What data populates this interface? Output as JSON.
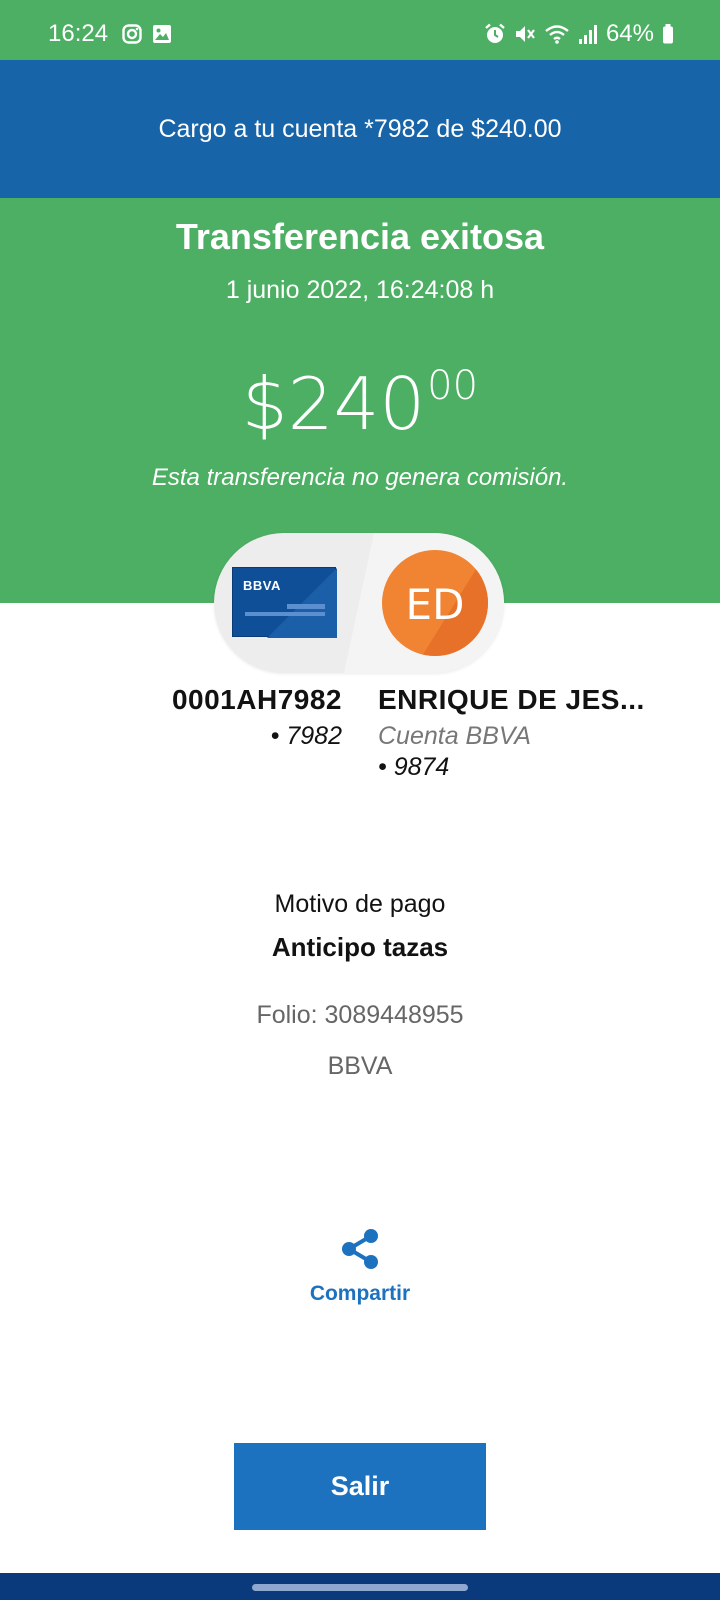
{
  "status_bar": {
    "time": "16:24",
    "battery": "64%",
    "left_icons": [
      "instagram-icon",
      "gallery-icon"
    ],
    "right_icons": [
      "alarm-icon",
      "mute-icon",
      "wifi-icon",
      "signal-icon",
      "battery-icon"
    ]
  },
  "banner": {
    "text": "Cargo a tu cuenta *7982 de $240.00"
  },
  "hero": {
    "title": "Transferencia exitosa",
    "date": "1 junio 2022, 16:24:08 h",
    "amount_main": "$240",
    "amount_cents": "00",
    "note": "Esta transferencia no genera comisión."
  },
  "origin": {
    "card_brand": "BBVA",
    "name": "0001AH7982",
    "number": "• 7982"
  },
  "destination": {
    "initials": "ED",
    "name": "ENRIQUE DE JES...",
    "bank": "Cuenta BBVA",
    "number": "• 9874"
  },
  "payment": {
    "reason_label": "Motivo de pago",
    "reason_value": "Anticipo tazas",
    "folio": "Folio: 3089448955",
    "bank": "BBVA"
  },
  "actions": {
    "share_label": "Compartir",
    "exit_label": "Salir"
  },
  "colors": {
    "green": "#4caf63",
    "blue_banner": "#1864a8",
    "button_blue": "#1d72c0",
    "avatar_orange": "#f08433",
    "nav_bar": "#0a3a7c"
  }
}
